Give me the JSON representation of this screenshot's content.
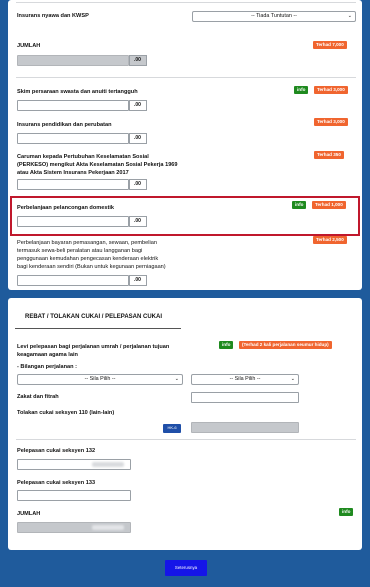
{
  "insurans_nyawa": {
    "label": "Insurans nyawa dan KWSP",
    "select": "-- Tiada Tuntutan --"
  },
  "jumlah1": {
    "label": "JUMLAH",
    "badge": "Terhad 7,000",
    "suffix": ".00"
  },
  "skim_persaraan": {
    "label": "Skim persaraan swasta dan anuiti tertangguh",
    "info": "info",
    "badge": "Terhad 3,000",
    "suffix": ".00"
  },
  "insurans_pendidikan": {
    "label": "Insurans pendidikan dan perubatan",
    "badge": "Terhad 3,000",
    "suffix": ".00"
  },
  "caruman_perkeso": {
    "label_lines": [
      "Caruman kepada Pertubuhan Keselamatan Sosial",
      "(PERKESO) mengikut Akta Keselamatan Sosial Pekerja 1969",
      "atau Akta Sistem Insurans Pekerjaan 2017"
    ],
    "badge": "Terhad 350",
    "suffix": ".00"
  },
  "pelancongan": {
    "label": "Perbelanjaan pelancongan domestik",
    "info": "info",
    "badge": "Terhad 1,000",
    "suffix": ".00"
  },
  "kenderaan_elektrik": {
    "label_lines": [
      "Perbelanjaan bayaran pemasangan, sewaan, pembelian",
      "termasuk sewa-beli peralatan atau langganan bagi",
      "penggunaan kemudahan pengecasan kenderaan elektrik",
      "bagi kenderaan sendiri (Bukan untuk kegunaan perniagaan)"
    ],
    "badge": "Terhad 2,500",
    "suffix": ".00"
  },
  "rebat": {
    "title": "REBAT / TOLAKAN CUKAI / PELEPASAN CUKAI",
    "levi_lines": [
      "Levi pelepasan bagi perjalanan umrah / perjalanan tujuan",
      "keagamaan agama lain"
    ],
    "levi_info": "info",
    "levi_badge": "(Terhad 2 kali perjalanan seumur hidup)",
    "bilangan": "- Bilangan perjalanan :",
    "select1": "-- Sila Pilih --",
    "select2": "-- Sila Pilih --",
    "zakat": "Zakat dan fitrah",
    "tolakan": "Tolakan cukai seksyen 110 (lain-lain)",
    "hkb_btn": "HK-6",
    "pelepasan132": "Pelepasan cukai seksyen 132",
    "pelepasan133": "Pelepasan cukai seksyen 133",
    "jumlah": "JUMLAH",
    "jumlah_info": "info"
  },
  "submit": "Seterusnya"
}
